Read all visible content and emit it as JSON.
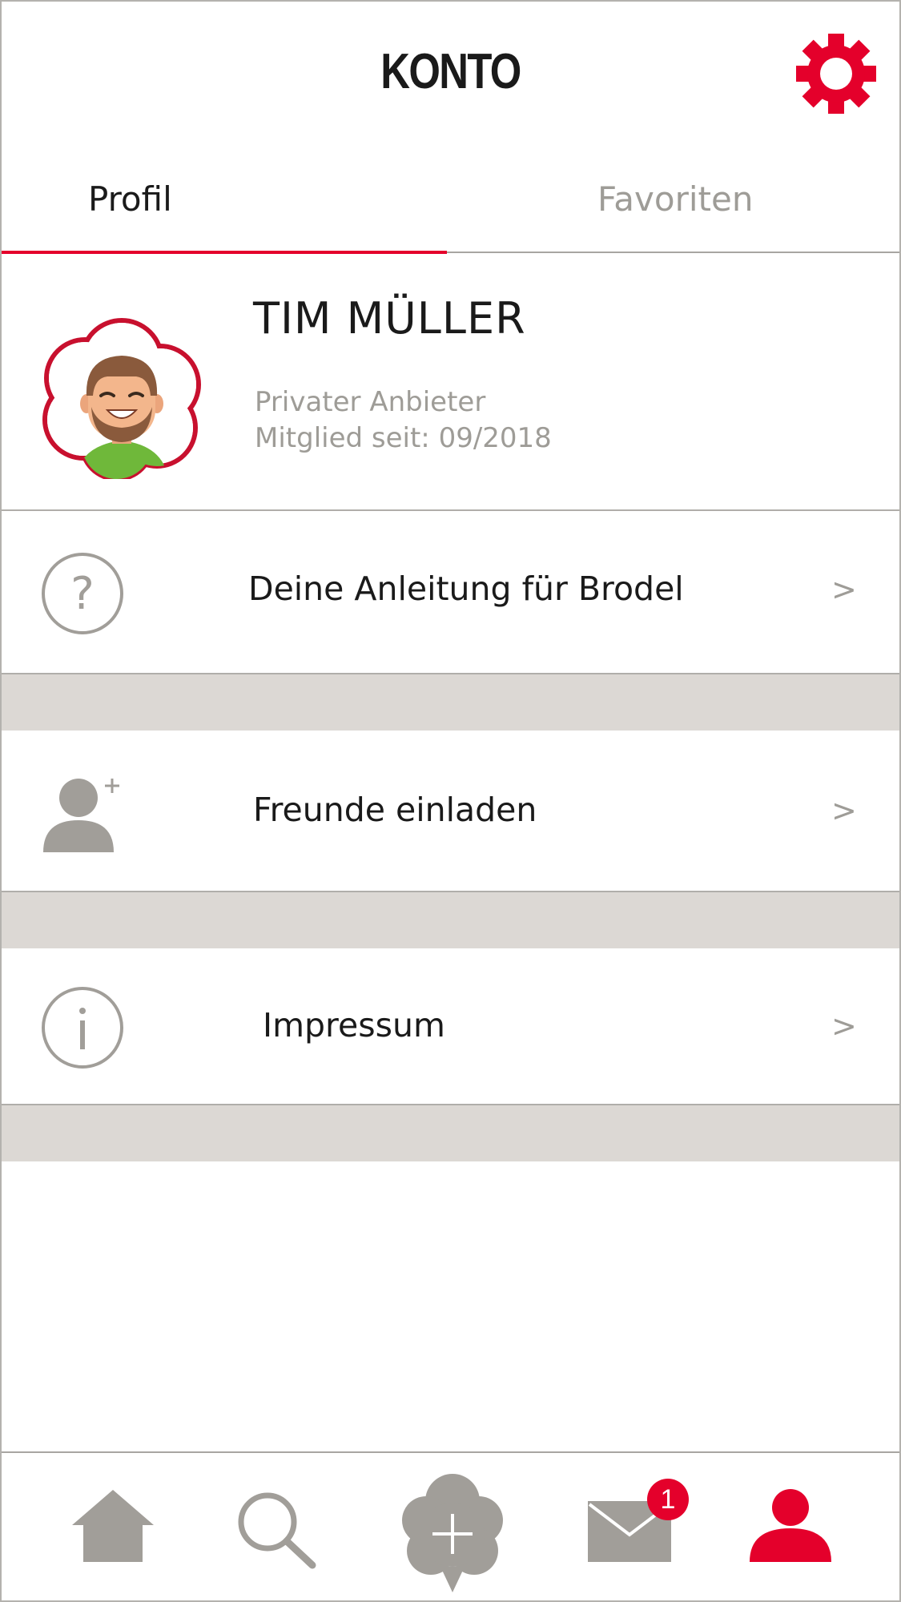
{
  "header": {
    "title": "KONTO",
    "settings_icon": "gear-icon"
  },
  "tabs": [
    {
      "label": "Profil",
      "active": true
    },
    {
      "label": "Favoriten",
      "active": false
    }
  ],
  "profile": {
    "name": "TIM MÜLLER",
    "type": "Privater Anbieter",
    "member_since": "Mitglied seit: 09/2018",
    "avatar_icon": "avatar-illustration"
  },
  "menu": [
    {
      "label": "Deine Anleitung für Brodel",
      "icon": "question-icon",
      "chevron": ">"
    },
    {
      "label": "Freunde einladen",
      "icon": "add-user-icon",
      "chevron": ">"
    },
    {
      "label": "Impressum",
      "icon": "info-icon",
      "chevron": ">"
    }
  ],
  "bottom_nav": {
    "items": [
      "home-icon",
      "search-icon",
      "add-listing-icon",
      "messages-icon",
      "profile-icon"
    ],
    "messages_badge": "1"
  },
  "colors": {
    "accent": "#e4002b",
    "icon_gray": "#a19e99",
    "separator": "#dcd8d4"
  }
}
